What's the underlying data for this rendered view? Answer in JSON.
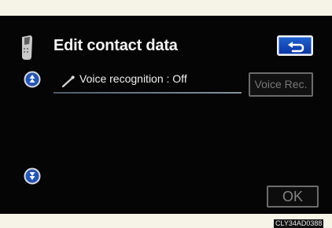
{
  "header": {
    "title": "Edit contact data",
    "phone_icon": "phone-icon",
    "back_icon": "return-arrow-icon"
  },
  "content": {
    "voice_recognition_text": "Voice recognition : Off",
    "voice_rec_label": "Voice Rec.",
    "ok_label": "OK"
  },
  "icons": {
    "microphone": "microphone-icon",
    "scroll_up": "scroll-up-icon",
    "scroll_down": "scroll-down-icon"
  },
  "colors": {
    "background": "#050505",
    "frame": "#f6f3e7",
    "accent_blue": "#1f62d0"
  },
  "footer": {
    "image_code": "CLY34AD0388"
  }
}
